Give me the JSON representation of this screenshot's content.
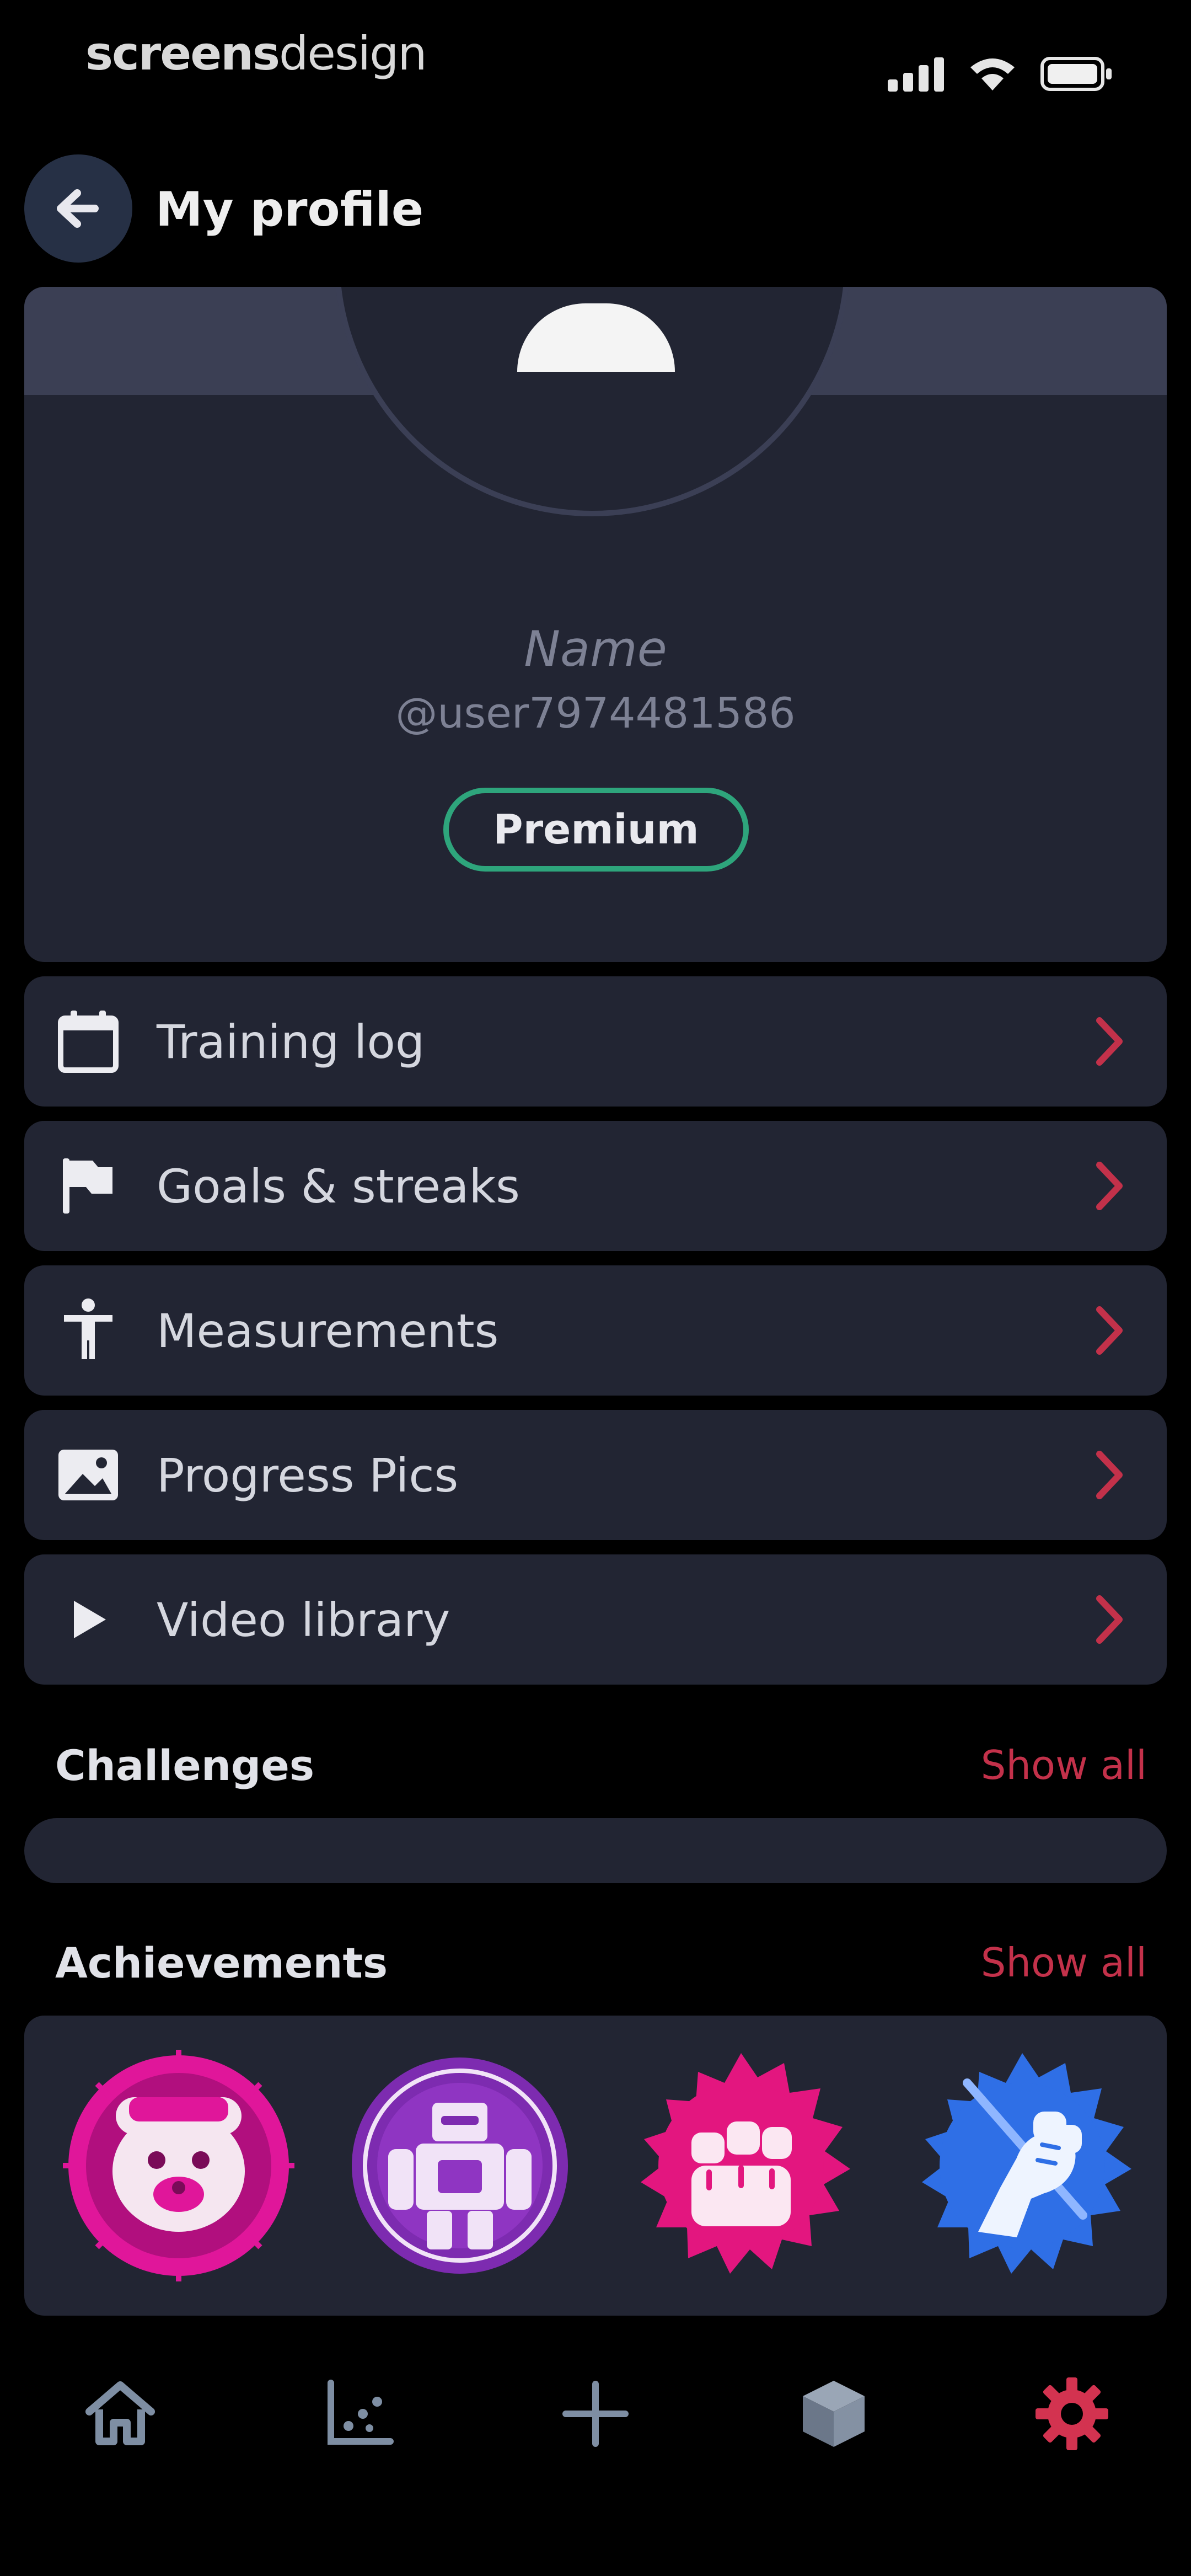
{
  "status_bar": {
    "brand_bold": "screens",
    "brand_light": "design"
  },
  "header": {
    "title": "My profile"
  },
  "profile": {
    "name": "Name",
    "handle": "@user7974481586",
    "badge": "Premium"
  },
  "menu": [
    {
      "label": "Training log",
      "icon": "calendar-icon"
    },
    {
      "label": "Goals & streaks",
      "icon": "flag-icon"
    },
    {
      "label": "Measurements",
      "icon": "body-figure-icon"
    },
    {
      "label": "Progress Pics",
      "icon": "image-icon"
    },
    {
      "label": "Video library",
      "icon": "play-icon"
    }
  ],
  "challenges": {
    "title": "Challenges",
    "show_all": "Show all"
  },
  "achievements": {
    "title": "Achievements",
    "show_all": "Show all",
    "badges": [
      "bear-badge-icon",
      "robot-badge-icon",
      "fist-badge-icon",
      "arm-badge-icon"
    ]
  },
  "nav": [
    {
      "icon": "home-icon",
      "active": false
    },
    {
      "icon": "chart-icon",
      "active": false
    },
    {
      "icon": "plus-icon",
      "active": false
    },
    {
      "icon": "cube-icon",
      "active": false
    },
    {
      "icon": "gear-icon",
      "active": true
    }
  ],
  "colors": {
    "background": "#000000",
    "card": "#222533",
    "accent_red": "#c3314a",
    "premium_green": "#2ea57c"
  }
}
